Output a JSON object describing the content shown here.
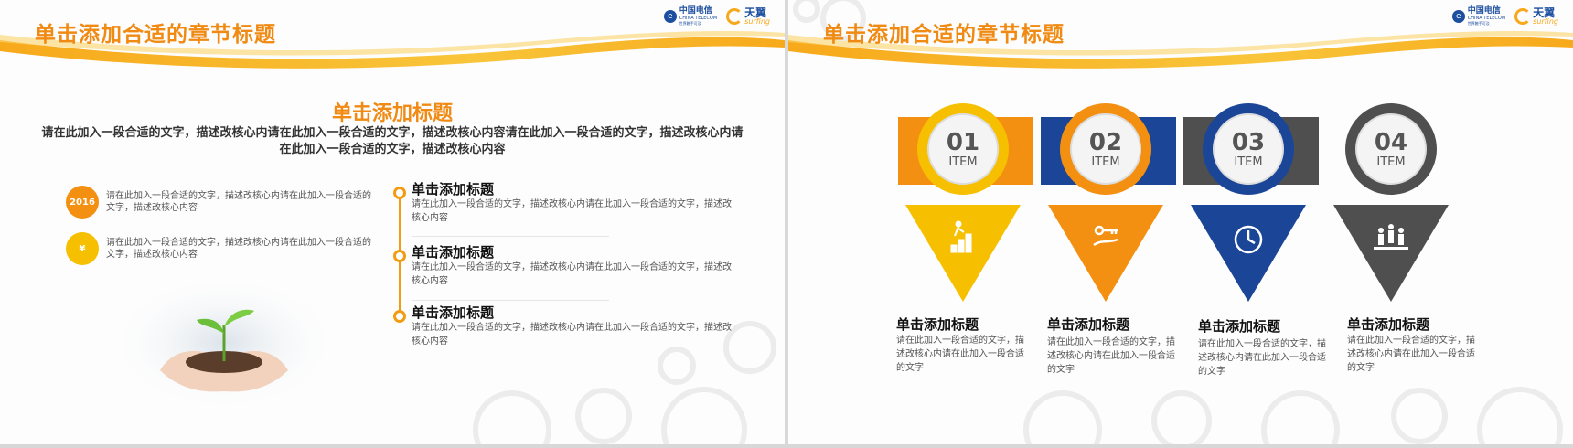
{
  "left_slide": {
    "title": "单击添加合适的章节标题",
    "logos": {
      "telecom_cn": "中国电信",
      "telecom_en": "CHINA TELECOM",
      "telecom_sub": "世界触手可及",
      "brand_cn": "天翼",
      "brand_en": "surfing"
    },
    "heading": "单击添加标题",
    "description": "请在此加入一段合适的文字，描述改核心内请在此加入一段合适的文字，描述改核心内容请在此加入一段合适的文字，描述改核心内请在此加入一段合适的文字，描述改核心内容",
    "features": [
      {
        "badge": "2016",
        "text": "请在此加入一段合适的文字，描述改核心内请在此加入一段合适的文字，描述改核心内容"
      },
      {
        "badge": "¥",
        "text": "请在此加入一段合适的文字，描述改核心内请在此加入一段合适的文字，描述改核心内容"
      }
    ],
    "timeline": [
      {
        "title": "单击添加标题",
        "desc": "请在此加入一段合适的文字，描述改核心内请在此加入一段合适的文字，描述改核心内容"
      },
      {
        "title": "单击添加标题",
        "desc": "请在此加入一段合适的文字，描述改核心内请在此加入一段合适的文字，描述改核心内容"
      },
      {
        "title": "单击添加标题",
        "desc": "请在此加入一段合适的文字，描述改核心内请在此加入一段合适的文字，描述改核心内容"
      }
    ]
  },
  "right_slide": {
    "title": "单击添加合适的章节标题",
    "logos": {
      "telecom_cn": "中国电信",
      "telecom_en": "CHINA TELECOM",
      "telecom_sub": "世界触手可及",
      "brand_cn": "天翼",
      "brand_en": "surfing"
    },
    "items": [
      {
        "num": "01",
        "label": "ITEM",
        "icon": "stairs-climb-icon",
        "color": "#f6c000",
        "title": "单击添加标题",
        "desc": "请在此加入一段合适的文字，描述改核心内请在此加入一段合适的文字"
      },
      {
        "num": "02",
        "label": "ITEM",
        "icon": "hand-key-icon",
        "color": "#f39012",
        "title": "单击添加标题",
        "desc": "请在此加入一段合适的文字，描述改核心内请在此加入一段合适的文字"
      },
      {
        "num": "03",
        "label": "ITEM",
        "icon": "clock-icon",
        "color": "#1b4596",
        "title": "单击添加标题",
        "desc": "请在此加入一段合适的文字，描述改核心内请在此加入一段合适的文字"
      },
      {
        "num": "04",
        "label": "ITEM",
        "icon": "team-podium-icon",
        "color": "#4f4f4f",
        "title": "单击添加标题",
        "desc": "请在此加入一段合适的文字，描述改核心内请在此加入一段合适的文字"
      }
    ]
  },
  "theme": {
    "accent": "#f08a12",
    "swoosh": "#f7b21b",
    "telecom_blue": "#1d4fa0"
  }
}
